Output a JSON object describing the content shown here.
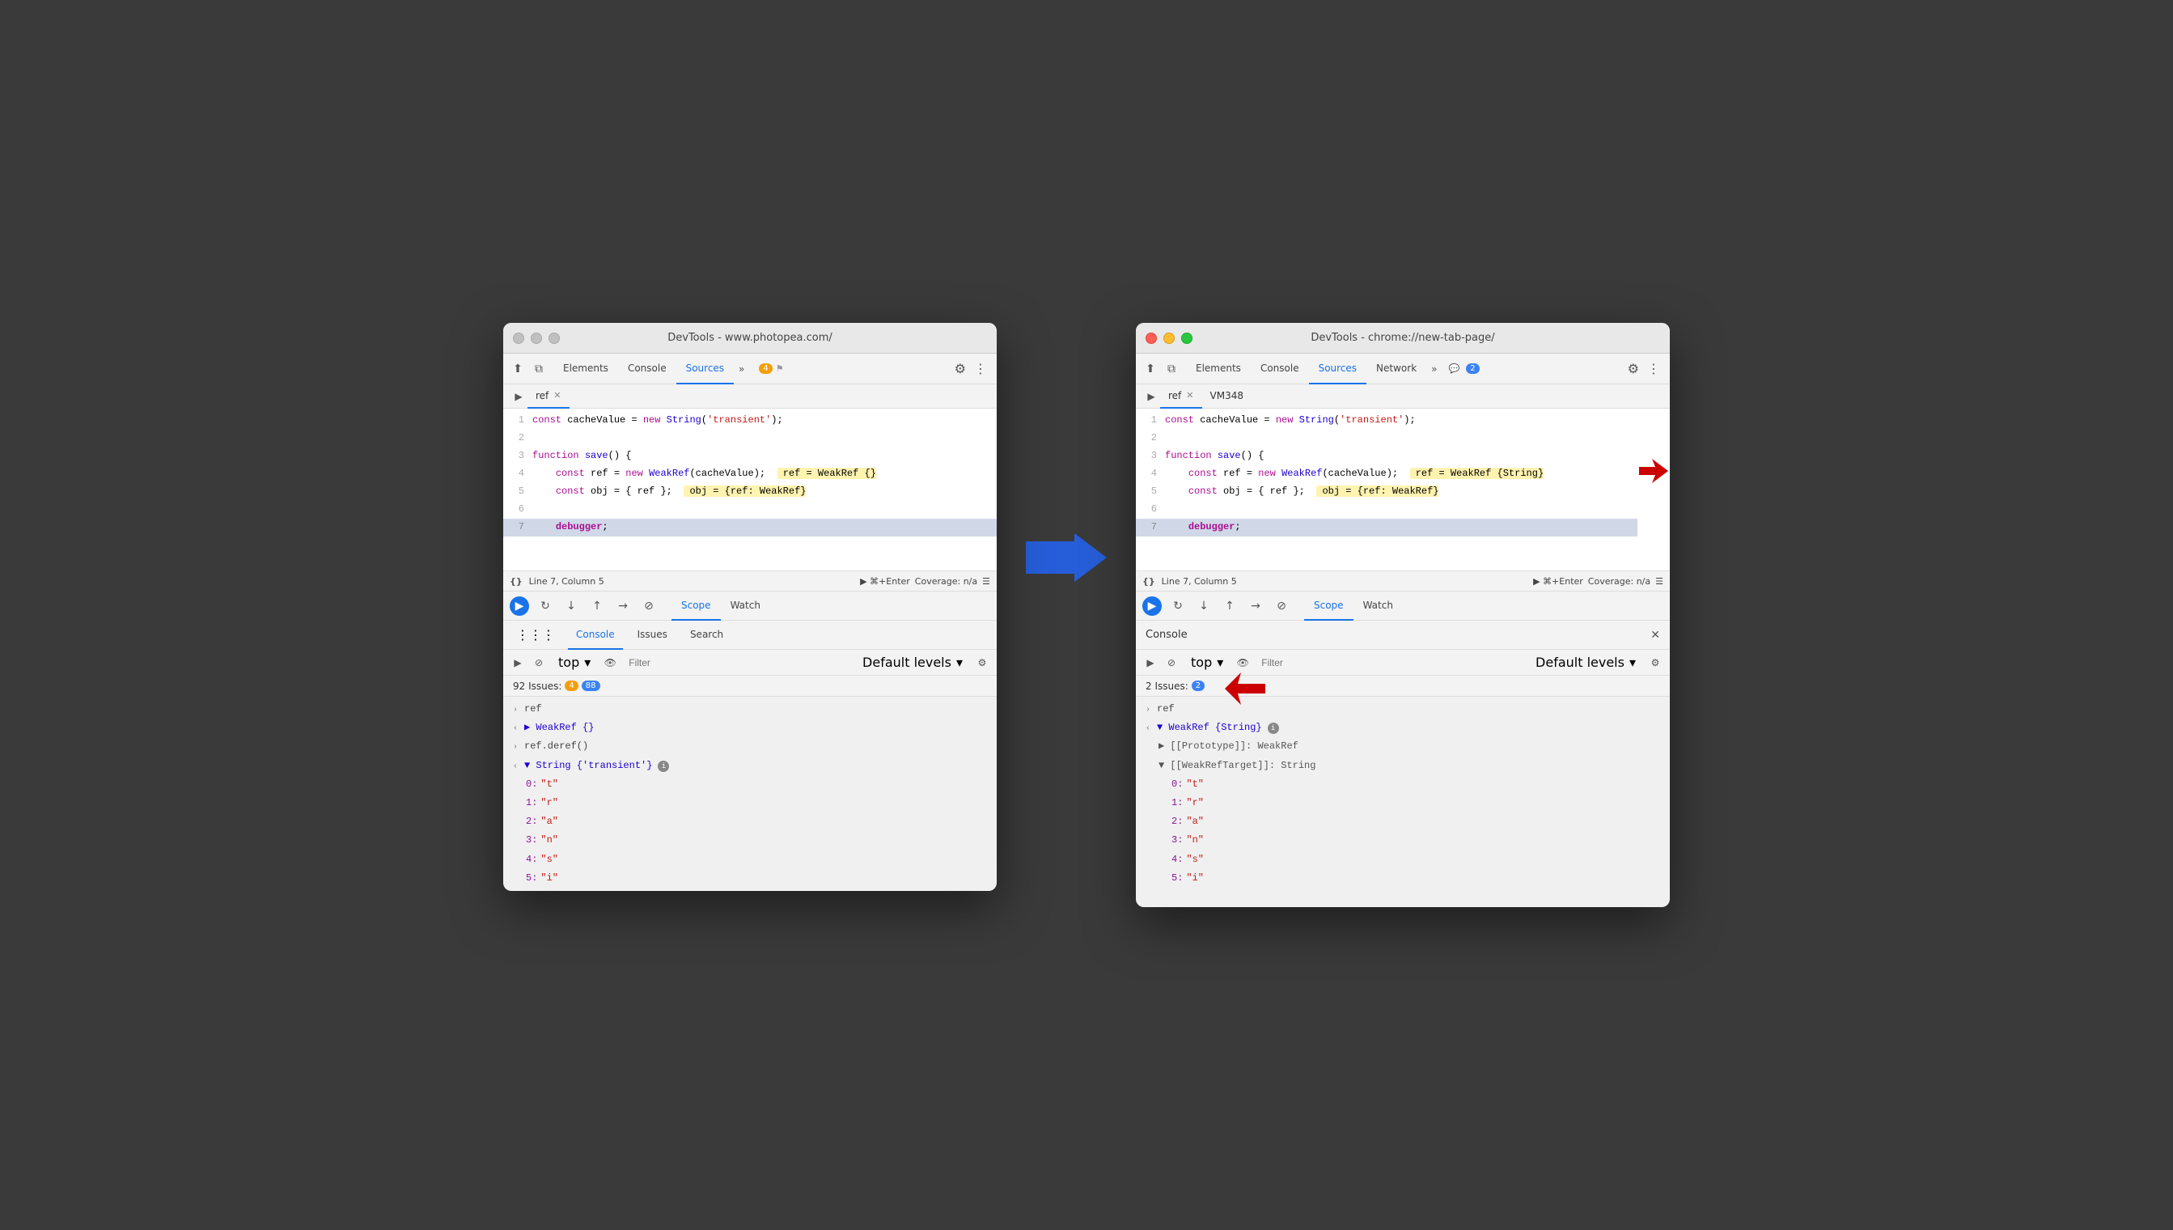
{
  "left_window": {
    "titlebar": {
      "title": "DevTools - www.photopea.com/"
    },
    "tabs": [
      "Elements",
      "Console",
      "Sources",
      "»"
    ],
    "active_tab": "Sources",
    "badge": "4",
    "file_tabs": [
      "ref"
    ],
    "code_lines": [
      {
        "num": 1,
        "content": "const cacheValue = new String('transient');"
      },
      {
        "num": 2,
        "content": ""
      },
      {
        "num": 3,
        "content": "function save() {"
      },
      {
        "num": 4,
        "content": "    const ref = new WeakRef(cacheValue);  ref = WeakRef {}"
      },
      {
        "num": 5,
        "content": "    const obj = { ref };  obj = {ref: WeakRef}"
      },
      {
        "num": 6,
        "content": ""
      },
      {
        "num": 7,
        "content": "    debugger;",
        "highlighted": true
      }
    ],
    "status": "Line 7, Column 5",
    "coverage": "Coverage: n/a",
    "debug_tabs": [
      "Scope",
      "Watch"
    ],
    "active_debug_tab": "Scope",
    "console_tabs": [
      "Console",
      "Issues",
      "Search"
    ],
    "active_console_tab": "Console",
    "console_filter_placeholder": "Filter",
    "console_top": "top",
    "console_levels": "Default levels",
    "issues_label": "92 Issues:",
    "issues_yellow": "4",
    "issues_blue": "88",
    "console_rows": [
      {
        "indent": 0,
        "arrow": ">",
        "text": "ref"
      },
      {
        "indent": 0,
        "arrow": "<",
        "text": "▶ WeakRef {}"
      },
      {
        "indent": 0,
        "arrow": ">",
        "text": "ref.deref()"
      },
      {
        "indent": 0,
        "arrow": "<",
        "text": "▼ String {'transient'} ℹ"
      },
      {
        "indent": 1,
        "text": "0: \"t\""
      },
      {
        "indent": 1,
        "text": "1: \"r\""
      },
      {
        "indent": 1,
        "text": "2: \"a\""
      },
      {
        "indent": 1,
        "text": "3: \"n\""
      },
      {
        "indent": 1,
        "text": "4: \"s\""
      },
      {
        "indent": 1,
        "text": "5: \"i\""
      }
    ]
  },
  "right_window": {
    "titlebar": {
      "title": "DevTools - chrome://new-tab-page/"
    },
    "tabs": [
      "Elements",
      "Console",
      "Sources",
      "Network",
      "»"
    ],
    "active_tab": "Sources",
    "badge_blue": "2",
    "file_tabs": [
      "ref",
      "VM348"
    ],
    "code_lines": [
      {
        "num": 1,
        "content": "const cacheValue = new String('transient');"
      },
      {
        "num": 2,
        "content": ""
      },
      {
        "num": 3,
        "content": "function save() {"
      },
      {
        "num": 4,
        "content": "    const ref = new WeakRef(cacheValue);  ref = WeakRef {String}"
      },
      {
        "num": 5,
        "content": "    const obj = { ref };  obj = {ref: WeakRef}"
      },
      {
        "num": 6,
        "content": ""
      },
      {
        "num": 7,
        "content": "    debugger;",
        "highlighted": true
      }
    ],
    "status": "Line 7, Column 5",
    "coverage": "Coverage: n/a",
    "debug_tabs": [
      "Scope",
      "Watch"
    ],
    "active_debug_tab": "Scope",
    "console_title": "Console",
    "console_filter_placeholder": "Filter",
    "console_top": "top",
    "console_levels": "Default levels",
    "issues_label": "2 Issues:",
    "issues_blue": "2",
    "console_rows": [
      {
        "indent": 0,
        "arrow": ">",
        "text": "ref"
      },
      {
        "indent": 0,
        "arrow": "<",
        "text": "▼ WeakRef {String} ℹ"
      },
      {
        "indent": 1,
        "text": "▶ [[Prototype]]: WeakRef"
      },
      {
        "indent": 1,
        "text": "▼ [[WeakRefTarget]]: String"
      },
      {
        "indent": 2,
        "text": "0: \"t\""
      },
      {
        "indent": 2,
        "text": "1: \"r\""
      },
      {
        "indent": 2,
        "text": "2: \"a\""
      },
      {
        "indent": 2,
        "text": "3: \"n\""
      },
      {
        "indent": 2,
        "text": "4: \"s\""
      },
      {
        "indent": 2,
        "text": "5: \"i\""
      }
    ]
  },
  "arrow": {
    "label": "→"
  },
  "icons": {
    "cursor": "⬆",
    "layers": "⧉",
    "play": "▶",
    "pause": "⏸",
    "step_over": "↷",
    "step_into": "↓",
    "step_out": "↑",
    "step": "→",
    "deactivate": "⊘",
    "eye": "👁",
    "gear": "⚙",
    "dots": "⋮",
    "brace": "{}",
    "close": "✕"
  }
}
